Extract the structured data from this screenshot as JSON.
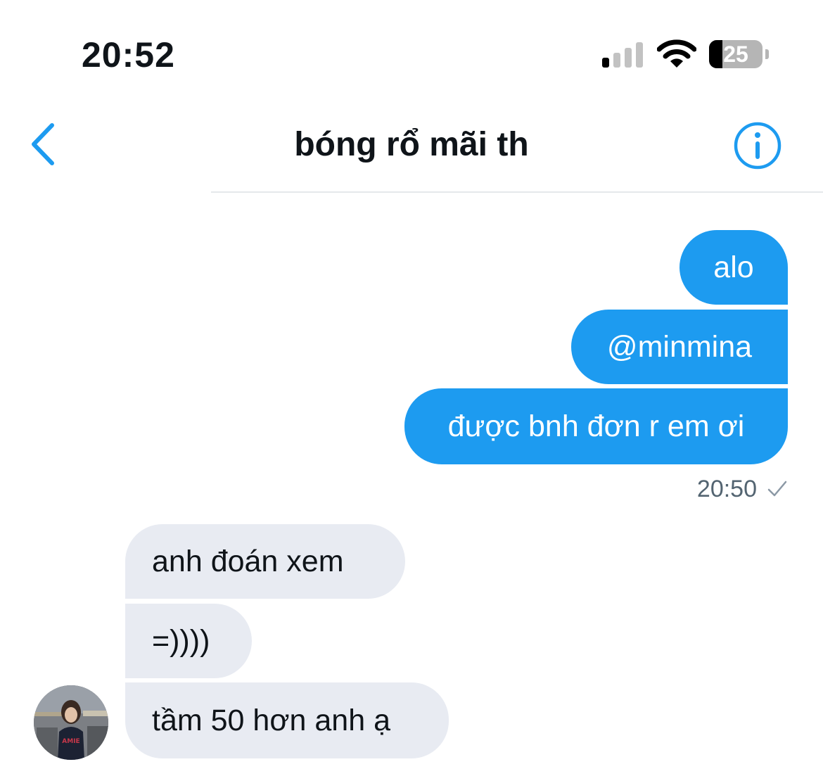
{
  "status_bar": {
    "time": "20:52",
    "battery_level": "25",
    "battery_percent": 25,
    "icons": [
      "cellular-signal-icon",
      "wifi-icon",
      "battery-icon"
    ]
  },
  "header": {
    "title": "bóng rổ mãi th",
    "back_icon": "chevron-left-icon",
    "info_icon": "info-icon"
  },
  "messages": {
    "outgoing": [
      "alo",
      "@minmina",
      "được bnh đơn r em ơi"
    ],
    "outgoing_time": "20:50",
    "outgoing_status_icon": "checkmark-icon",
    "incoming": [
      "anh đoán xem",
      "=))))",
      "tầm 50 hơn anh ạ"
    ]
  },
  "colors": {
    "accent": "#1d9bf0",
    "incoming_bubble": "#e8ebf2",
    "meta_text": "#536471"
  }
}
